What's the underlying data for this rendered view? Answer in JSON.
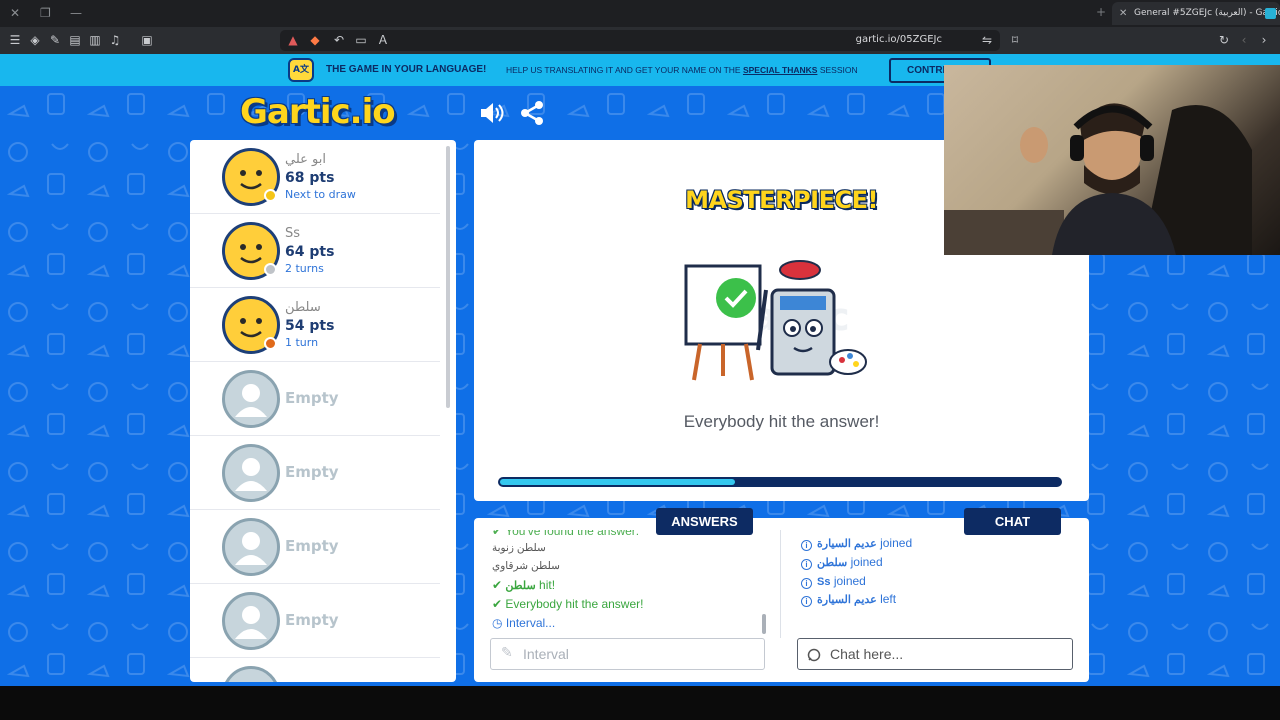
{
  "browser": {
    "tab_title": "General #5ZGEJc (العربية) - Gartic",
    "url": "gartic.io/05ZGEJc"
  },
  "banner": {
    "title": "THE GAME IN YOUR LANGUAGE!",
    "text": "HELP US TRANSLATING IT AND GET YOUR NAME ON THE",
    "link": "SPECIAL THANKS",
    "text_suffix": "SESSION",
    "button": "CONTRI"
  },
  "logo": "Gartic.io",
  "players": [
    {
      "name": "ابو علي",
      "points": "68 pts",
      "status": "Next to draw",
      "dot_color": "#f5c518"
    },
    {
      "name": "Ss",
      "points": "64 pts",
      "status": "2 turns",
      "dot_color": "#bfc3c8"
    },
    {
      "name": "سلطن",
      "points": "54 pts",
      "status": "1 turn",
      "dot_color": "#e06a1b"
    },
    {
      "empty": "Empty"
    },
    {
      "empty": "Empty"
    },
    {
      "empty": "Empty"
    },
    {
      "empty": "Empty"
    }
  ],
  "canvas": {
    "headline": "MASTERPIECE!",
    "message": "Everybody hit the answer!",
    "progress": 0.42
  },
  "answers": {
    "tab": "ANSWERS",
    "items": [
      {
        "text": "You've found the answer:"
      },
      {
        "text": "سلطن زنوبة"
      },
      {
        "text": "سلطن شرقاوي"
      },
      {
        "user": "سلطن",
        "text": "hit!"
      },
      {
        "text": "Everybody hit the answer!"
      },
      {
        "text": "Interval..."
      }
    ],
    "placeholder": "Interval"
  },
  "chat": {
    "tab": "CHAT",
    "items": [
      {
        "user": "عديم السيارة",
        "text": "joined"
      },
      {
        "user": "سلطن",
        "text": "joined"
      },
      {
        "user": "Ss",
        "text": "joined"
      },
      {
        "user": "عديم السيارة",
        "text": "left"
      }
    ],
    "placeholder": "Chat here..."
  },
  "colors": {
    "page_bg": "#0f6fe7",
    "banner_bg": "#18b7ee",
    "navy": "#0d2b63",
    "yellow": "#ffd51c",
    "green": "#3aa63f",
    "blue_text": "#2f74d8"
  }
}
